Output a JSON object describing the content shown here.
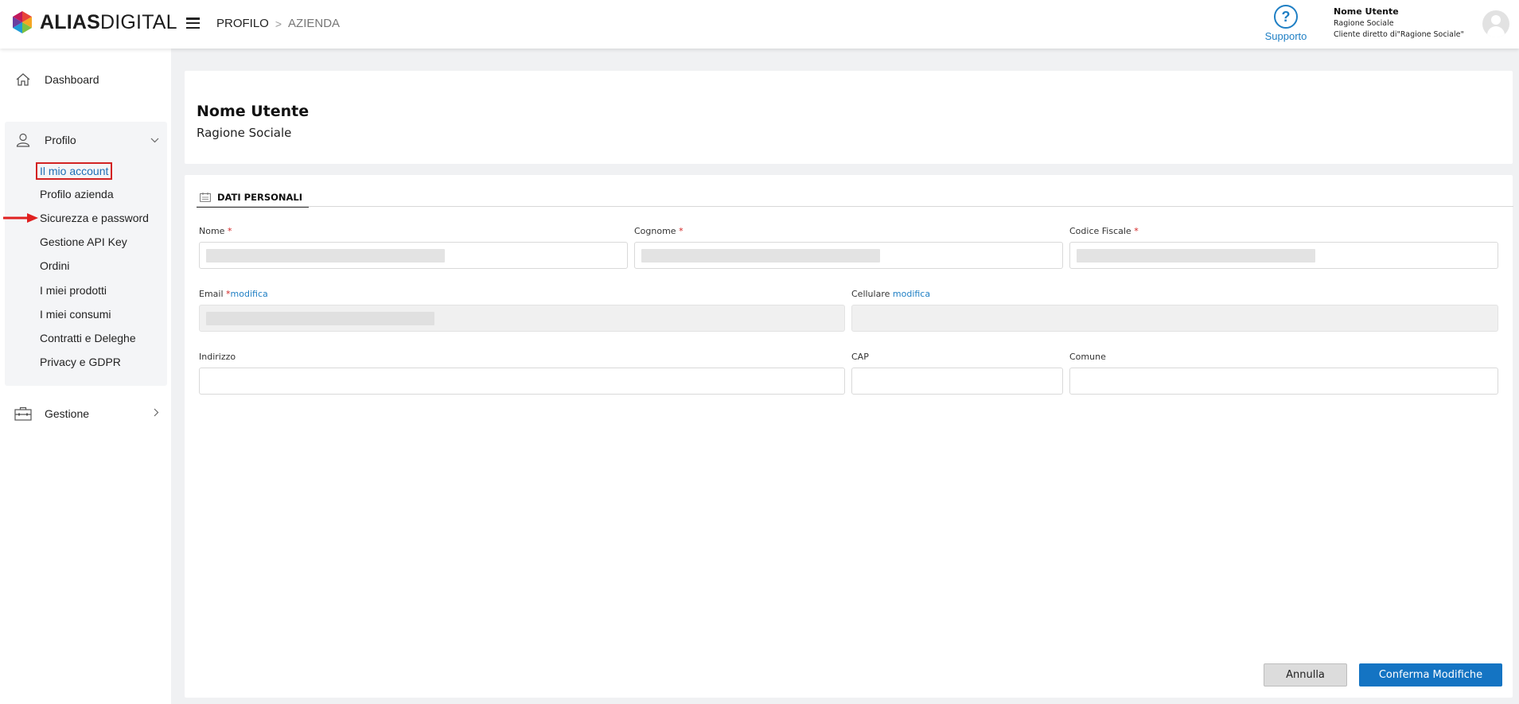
{
  "brand": {
    "bold": "ALIAS",
    "regular": "DIGITAL"
  },
  "breadcrumb": {
    "item1": "PROFILO",
    "separator": ">",
    "item2": "AZIENDA"
  },
  "support": {
    "icon_glyph": "?",
    "label": "Supporto"
  },
  "user": {
    "name": "Nome Utente",
    "company": "Ragione Sociale",
    "client_line": "Cliente diretto di\"Ragione Sociale\""
  },
  "sidebar": {
    "dashboard": "Dashboard",
    "profilo": "Profilo",
    "profilo_items": [
      "Il mio account",
      "Profilo azienda",
      "Sicurezza e password",
      "Gestione API Key",
      "Ordini",
      "I miei prodotti",
      "I miei consumi",
      "Contratti e Deleghe",
      "Privacy e GDPR"
    ],
    "gestione": "Gestione"
  },
  "header_card": {
    "name": "Nome Utente",
    "company": "Ragione Sociale"
  },
  "form": {
    "tab_label": "DATI PERSONALI",
    "nome_label": "Nome",
    "cognome_label": "Cognome",
    "codice_fiscale_label": "Codice Fiscale",
    "email_label": "Email",
    "cellulare_label": "Cellulare",
    "modifica": "modifica",
    "indirizzo_label": "Indirizzo",
    "cap_label": "CAP",
    "comune_label": "Comune",
    "required_mark": "*"
  },
  "buttons": {
    "cancel": "Annulla",
    "confirm": "Conferma Modifiche"
  },
  "colors": {
    "accent": "#1f7fc4",
    "primary_button": "#1474c3",
    "highlight": "#d32323",
    "required": "#d32323"
  },
  "icons": {
    "logo": "alias-digital-logo-icon",
    "menu": "hamburger-menu-icon",
    "support": "question-circle-icon",
    "avatar": "user-avatar-icon",
    "dashboard": "home-icon",
    "profilo": "user-icon",
    "gestione": "briefcase-icon",
    "tab": "id-card-icon",
    "arrow": "red-arrow-icon"
  }
}
